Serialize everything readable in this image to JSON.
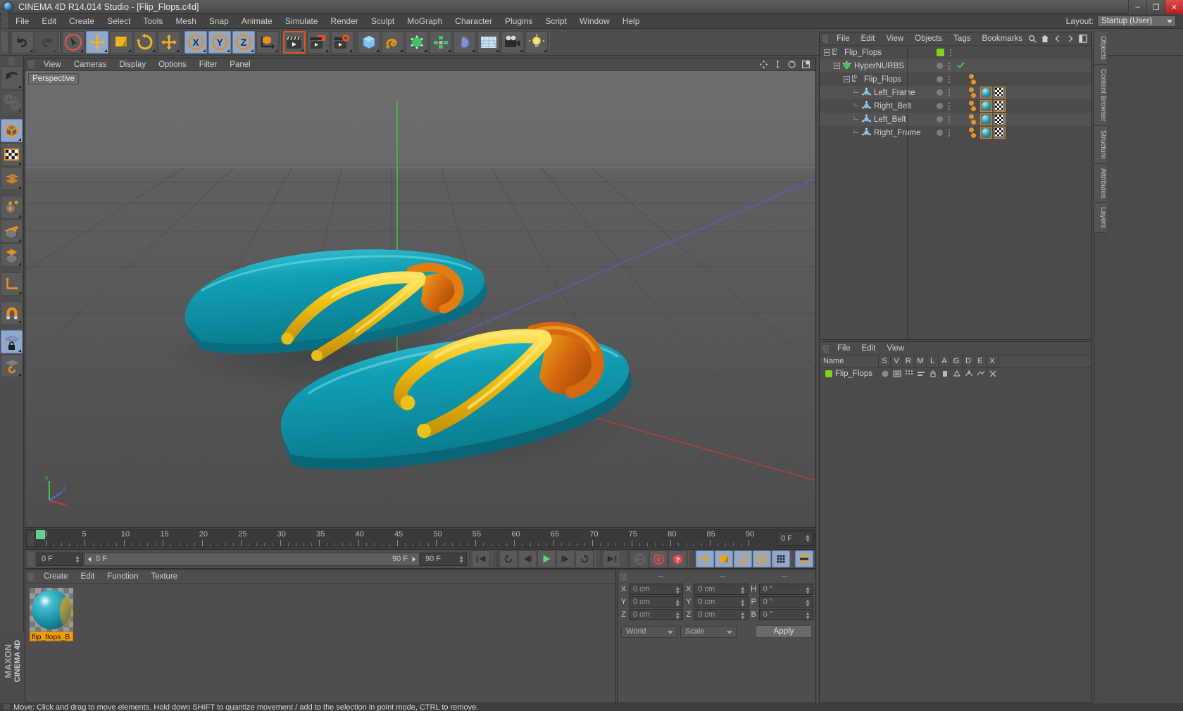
{
  "window": {
    "title": "CINEMA 4D R14.014 Studio - [Flip_Flops.c4d]",
    "minimize": "–",
    "maximize": "❐",
    "close": "✕"
  },
  "menubar": {
    "items": [
      "File",
      "Edit",
      "Create",
      "Select",
      "Tools",
      "Mesh",
      "Snap",
      "Animate",
      "Simulate",
      "Render",
      "Sculpt",
      "MoGraph",
      "Character",
      "Plugins",
      "Script",
      "Window",
      "Help"
    ],
    "layout_label": "Layout:",
    "layout_value": "Startup (User)"
  },
  "toolbar": {
    "groups": [
      {
        "buttons": [
          {
            "name": "undo-button",
            "icon": "undo",
            "state": "normal"
          },
          {
            "name": "redo-button",
            "icon": "redo",
            "state": "disabled"
          }
        ]
      },
      {
        "buttons": [
          {
            "name": "live-selection-button",
            "icon": "cursor-circle",
            "state": "normal"
          },
          {
            "name": "move-tool-button",
            "icon": "move",
            "state": "selected"
          },
          {
            "name": "scale-tool-button",
            "icon": "scale",
            "state": "normal"
          },
          {
            "name": "rotate-tool-button",
            "icon": "rotate",
            "state": "normal"
          },
          {
            "name": "move-extra-button",
            "icon": "move",
            "state": "normal"
          }
        ]
      },
      {
        "buttons": [
          {
            "name": "x-axis-button",
            "icon": "axis-x",
            "state": "selected"
          },
          {
            "name": "y-axis-button",
            "icon": "axis-y",
            "state": "selected"
          },
          {
            "name": "z-axis-button",
            "icon": "axis-z",
            "state": "selected"
          },
          {
            "name": "world-object-axis-button",
            "icon": "world-axis",
            "state": "normal"
          }
        ]
      },
      {
        "buttons": [
          {
            "name": "render-view-button",
            "icon": "clapper",
            "state": "active"
          },
          {
            "name": "render-region-button",
            "icon": "clapper-region",
            "state": "normal"
          },
          {
            "name": "render-settings-button",
            "icon": "clapper-gear",
            "state": "normal"
          }
        ]
      },
      {
        "buttons": [
          {
            "name": "cube-primitive-button",
            "icon": "cube",
            "state": "normal"
          },
          {
            "name": "spline-button",
            "icon": "spline",
            "state": "normal"
          },
          {
            "name": "nurbs-button",
            "icon": "hypernurbs",
            "state": "normal"
          },
          {
            "name": "array-button",
            "icon": "array",
            "state": "normal"
          },
          {
            "name": "bend-deformer-button",
            "icon": "bend",
            "state": "normal"
          },
          {
            "name": "floor-environment-button",
            "icon": "floor",
            "state": "normal"
          },
          {
            "name": "camera-button",
            "icon": "camera",
            "state": "normal"
          },
          {
            "name": "light-button",
            "icon": "light",
            "state": "normal"
          }
        ]
      }
    ]
  },
  "left_toolbar": {
    "buttons": [
      {
        "name": "undo-view-button",
        "icon": "undo-arrow",
        "state": "normal"
      },
      {
        "name": "global-local-coordinates-button",
        "icon": "globe-axis",
        "state": "disabled"
      },
      {
        "name": "model-mode-button",
        "icon": "cube-model",
        "state": "selected"
      },
      {
        "name": "texture-mode-button",
        "icon": "checker",
        "state": "normal"
      },
      {
        "name": "polygon-mode-button",
        "icon": "mesh-grid",
        "state": "normal"
      },
      {
        "name": "points-mode-button",
        "icon": "cube-points",
        "state": "normal"
      },
      {
        "name": "edges-mode-button",
        "icon": "cube-edges",
        "state": "normal"
      },
      {
        "name": "polygons-mode-button",
        "icon": "cube-polygon",
        "state": "normal"
      },
      {
        "name": "axis-modify-button",
        "icon": "axis-l",
        "state": "normal"
      },
      {
        "name": "enable-snap-button",
        "icon": "magnet",
        "state": "normal"
      },
      {
        "name": "workplane-lock-button",
        "icon": "grid-lock",
        "state": "selected"
      },
      {
        "name": "workplane-reset-button",
        "icon": "grid-reset",
        "state": "normal"
      }
    ]
  },
  "viewport": {
    "menu": [
      "View",
      "Cameras",
      "Display",
      "Options",
      "Filter",
      "Panel"
    ],
    "label": "Perspective",
    "axis": {
      "x": "X",
      "y": "Y",
      "z": "Z"
    },
    "colors": {
      "background_top": "#6c6c6c",
      "background_bottom": "#4f4f4f",
      "sandal_teal": "#0f93a8",
      "strap_yellow": "#f2c515",
      "strap_orange": "#d4690f",
      "grid_line": "#4a4a4a",
      "axis_y": "#44d04a",
      "axis_x": "#d03a3a",
      "axis_z": "#5a5ad0"
    }
  },
  "timeline": {
    "ticks": [
      0,
      5,
      10,
      15,
      20,
      25,
      30,
      35,
      40,
      45,
      50,
      55,
      60,
      65,
      70,
      75,
      80,
      85,
      90
    ],
    "current_frame_marker": 0,
    "frame_field": "0 F"
  },
  "transport": {
    "current_frame": "0 F",
    "range_start": "0 F",
    "range_end": "90 F",
    "end_frame": "90 F",
    "buttons": [
      {
        "name": "go-to-start-button",
        "icon": "skip-start"
      },
      {
        "name": "previous-keyframe-button",
        "icon": "prev-key"
      },
      {
        "name": "step-back-button",
        "icon": "step-back"
      },
      {
        "name": "play-button",
        "icon": "play"
      },
      {
        "name": "step-forward-button",
        "icon": "step-forward"
      },
      {
        "name": "next-keyframe-button",
        "icon": "next-key"
      },
      {
        "name": "go-to-end-button",
        "icon": "skip-end"
      },
      {
        "name": "record-active-objects-button",
        "icon": "key"
      },
      {
        "name": "autokeying-button",
        "icon": "record"
      },
      {
        "name": "keyframe-selection-button",
        "icon": "question"
      },
      {
        "name": "position-key-button",
        "icon": "move"
      },
      {
        "name": "scale-key-button",
        "icon": "scale"
      },
      {
        "name": "rotation-key-button",
        "icon": "rotate"
      },
      {
        "name": "parameter-key-button",
        "icon": "param"
      },
      {
        "name": "point-level-animation-button",
        "icon": "pla"
      },
      {
        "name": "animation-layers-button",
        "icon": "layers"
      }
    ]
  },
  "material_manager": {
    "menu": [
      "Create",
      "Edit",
      "Function",
      "Texture"
    ],
    "materials": [
      {
        "name": "flip_flops_B",
        "display": "flip_flops_B"
      }
    ]
  },
  "coordinates": {
    "headers": [
      "--",
      "--",
      "--"
    ],
    "rows": [
      {
        "label_pos": "X",
        "pos": "0 cm",
        "label_size": "X",
        "size": "0 cm",
        "label_rot": "H",
        "rot": "0 °"
      },
      {
        "label_pos": "Y",
        "pos": "0 cm",
        "label_size": "Y",
        "size": "0 cm",
        "label_rot": "P",
        "rot": "0 °"
      },
      {
        "label_pos": "Z",
        "pos": "0 cm",
        "label_size": "Z",
        "size": "0 cm",
        "label_rot": "B",
        "rot": "0 °"
      }
    ],
    "system": "World",
    "mode": "Scale",
    "apply": "Apply"
  },
  "object_manager": {
    "menu": [
      "File",
      "Edit",
      "View",
      "Objects",
      "Tags",
      "Bookmarks"
    ],
    "rows": [
      {
        "name": "Flip_Flops",
        "indent": 0,
        "type": "null",
        "expanded": true,
        "layer_color": "#7ed321",
        "tags": []
      },
      {
        "name": "HyperNURBS",
        "indent": 1,
        "type": "hypernurbs",
        "expanded": true,
        "check": true,
        "tags": []
      },
      {
        "name": "Flip_Flops",
        "indent": 2,
        "type": "null",
        "expanded": true,
        "tags": [
          "dot",
          "dot"
        ]
      },
      {
        "name": "Left_Frame",
        "indent": 3,
        "type": "polygon",
        "tags": [
          "dot",
          "dot",
          "material",
          "uvw"
        ]
      },
      {
        "name": "Right_Belt",
        "indent": 3,
        "type": "polygon",
        "tags": [
          "dot",
          "dot",
          "material",
          "uvw"
        ]
      },
      {
        "name": "Left_Belt",
        "indent": 3,
        "type": "polygon",
        "tags": [
          "dot",
          "dot",
          "material",
          "uvw"
        ]
      },
      {
        "name": "Right_Frame",
        "indent": 3,
        "type": "polygon",
        "tags": [
          "dot",
          "dot",
          "material",
          "uvw"
        ]
      }
    ]
  },
  "layer_manager": {
    "menu": [
      "File",
      "Edit",
      "View"
    ],
    "columns": [
      "Name",
      "S",
      "V",
      "R",
      "M",
      "L",
      "A",
      "G",
      "D",
      "E",
      "X"
    ],
    "rows": [
      {
        "name": "Flip_Flops",
        "color": "#7ed321"
      }
    ]
  },
  "right_tabs": [
    "Objects",
    "Content Browser",
    "Structure",
    "Attributes",
    "Layers"
  ],
  "brand": {
    "line1": "MAXON",
    "line2": "CINEMA 4D"
  },
  "statusbar": {
    "message": "Move: Click and drag to move elements. Hold down SHIFT to quantize movement / add to the selection in point mode, CTRL to remove."
  }
}
